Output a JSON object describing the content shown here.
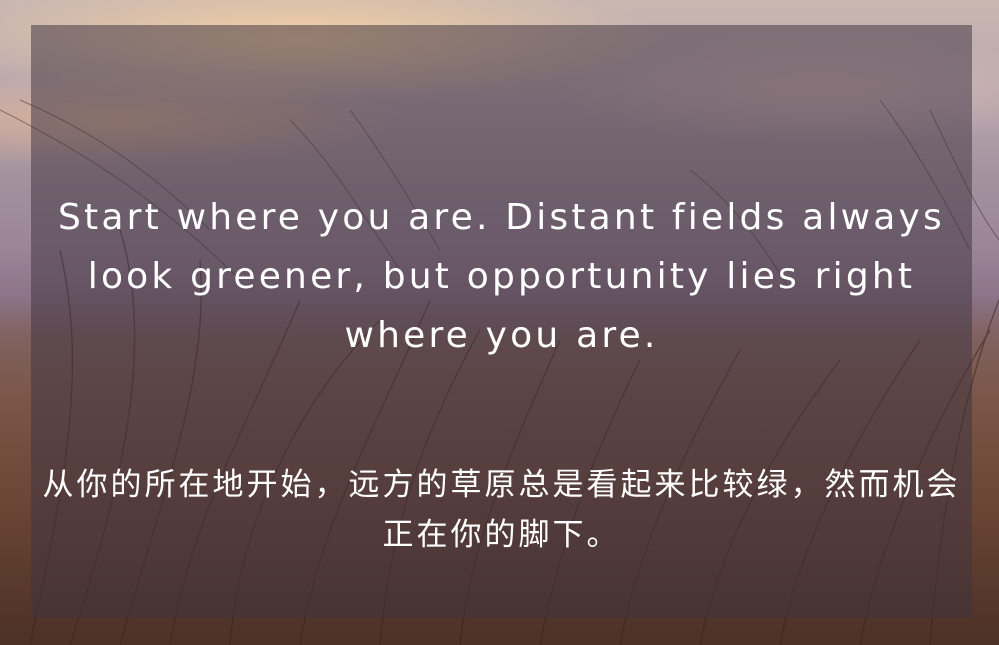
{
  "background": {
    "description_icon": "wheat-field-sunset-photo",
    "sky_color": "#b9a7ad",
    "field_color": "#6d4838"
  },
  "overlay": {
    "color": "#403442"
  },
  "quote": {
    "english": "Start where you are. Distant fields always look greener, but opportunity lies right where you are.",
    "chinese": "从你的所在地开始，远方的草原总是看起来比较绿，然而机会正在你的脚下。"
  }
}
